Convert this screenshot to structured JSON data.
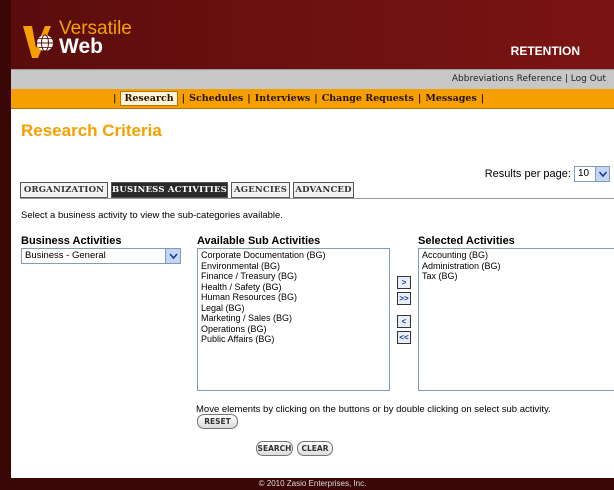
{
  "brand": {
    "line1": "Versatile",
    "line2": "Web",
    "section_title": "RETENTION",
    "accent": "#f5a000",
    "dark": "#5a0c0c"
  },
  "util_links": {
    "abbreviations": "Abbreviations Reference",
    "separator": "|",
    "logout": "Log Out"
  },
  "nav": {
    "items": [
      "Research",
      "Schedules",
      "Interviews",
      "Change Requests",
      "Messages"
    ],
    "active": "Research"
  },
  "page": {
    "title": "Research Criteria",
    "results_per_page_label": "Results per page:",
    "results_per_page_value": "10"
  },
  "tabs": [
    "ORGANIZATION",
    "BUSINESS ACTIVITIES",
    "AGENCIES",
    "ADVANCED"
  ],
  "active_tab": "BUSINESS ACTIVITIES",
  "instruction": "Select a business activity to view the sub-categories available.",
  "business_activities": {
    "label": "Business Activities",
    "selected": "Business - General"
  },
  "available": {
    "label": "Available Sub Activities",
    "items": [
      "Corporate Documentation (BG)",
      "Environmental (BG)",
      "Finance / Treasury (BG)",
      "Health / Safety (BG)",
      "Human Resources (BG)",
      "Legal (BG)",
      "Marketing / Sales (BG)",
      "Operations (BG)",
      "Public Affairs (BG)"
    ]
  },
  "selected_activities": {
    "label": "Selected Activities",
    "items": [
      "Accounting (BG)",
      "Administration (BG)",
      "Tax (BG)"
    ]
  },
  "move_buttons": {
    "add": ">",
    "add_all": ">>",
    "remove": "<",
    "remove_all": "<<"
  },
  "hint": "Move elements by clicking on the buttons or by double clicking on select sub activity.",
  "buttons": {
    "reset": "RESET",
    "search": "SEARCH",
    "clear": "CLEAR"
  },
  "footer": "© 2010 Zasio Enterprises, Inc."
}
